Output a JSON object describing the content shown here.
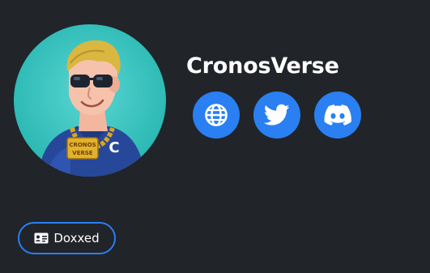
{
  "profile": {
    "name": "CronosVerse",
    "avatar_chain_text_left": "CRONOS",
    "avatar_chain_text_right": "VERSE",
    "avatar_shirt_letter": "C"
  },
  "socials": [
    {
      "icon": "globe-icon"
    },
    {
      "icon": "twitter-icon"
    },
    {
      "icon": "discord-icon"
    }
  ],
  "badge": {
    "label": "Doxxed",
    "icon": "id-card-icon"
  },
  "colors": {
    "background": "#212429",
    "accent": "#2a7ff2",
    "avatar_bg": "#2fc4bf"
  }
}
